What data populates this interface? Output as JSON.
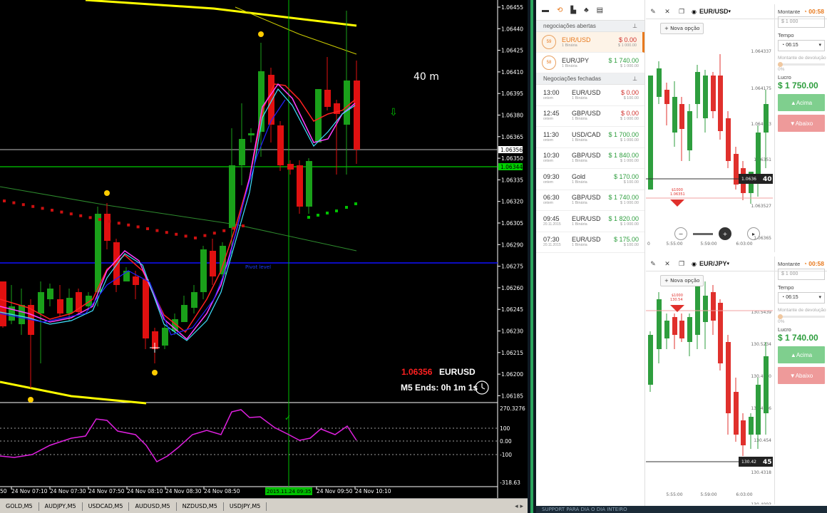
{
  "metatrader": {
    "price_axis": [
      "1.06455",
      "1.06440",
      "1.06425",
      "1.06410",
      "1.06395",
      "1.06380",
      "1.06365",
      "1.06350",
      "1.06335",
      "1.06320",
      "1.06305",
      "1.06290",
      "1.06275",
      "1.06260",
      "1.06245",
      "1.06230",
      "1.06215",
      "1.06200",
      "1.06185"
    ],
    "bid_label": "1.06356",
    "current_label": "1.06344",
    "current_price": "1.06356",
    "symbol": "EURUSD",
    "timeframe_note": "40 m",
    "countdown": "M5 Ends: 0h 1m 1s",
    "pivot_label": "Pivot level",
    "rsi_axis": [
      "270.3276",
      "100",
      "0.00",
      "-100",
      "-318.63"
    ],
    "time_axis": [
      "24 Nov 07:10",
      "24 Nov 07:30",
      "24 Nov 07:50",
      "24 Nov 08:10",
      "24 Nov 08:30",
      "24 Nov 08:50",
      "24 Nov 09:50",
      "24 Nov 10:10"
    ],
    "time_first": "50",
    "crosshair_time": "2015.11.24 09:35",
    "symbol_tabs": [
      "GOLD,M5",
      "AUDJPY,M5",
      "USDCAD,M5",
      "AUDUSD,M5",
      "NZDUSD,M5",
      "USDJPY,M5"
    ],
    "colors": {
      "up": "#1aa01a",
      "down": "#e01010",
      "price_line": "#00ff00",
      "envelope": "#ffff00"
    }
  },
  "platform": {
    "toolbar_icons": [
      "menu-icon",
      "history-icon",
      "chart-icon",
      "people-icon",
      "news-icon"
    ],
    "open_section": "negociações abertas",
    "open_trades": [
      {
        "timer": "59",
        "asset": "EUR/USD",
        "sub": "1 Binária",
        "amount": "$ 0.00",
        "stake": "$ 1 000.00",
        "color": "red"
      },
      {
        "timer": "58",
        "asset": "EUR/JPY",
        "sub": "1 Binária",
        "amount": "$ 1 740.00",
        "stake": "$ 1 000.00",
        "color": "green"
      }
    ],
    "closed_section": "Negociações fechadas",
    "closed_trades": [
      {
        "time": "13:00",
        "day": "ontem",
        "asset": "EUR/USD",
        "sub": "1 Binária",
        "amount": "$ 0.00",
        "stake": "$ 100.00",
        "color": "red"
      },
      {
        "time": "12:45",
        "day": "ontem",
        "asset": "GBP/USD",
        "sub": "1 Binária",
        "amount": "$ 0.00",
        "stake": "$ 1 000.00",
        "color": "red"
      },
      {
        "time": "11:30",
        "day": "ontem",
        "asset": "USD/CAD",
        "sub": "1 Binária",
        "amount": "$ 1 700.00",
        "stake": "$ 1 000.00",
        "color": "green"
      },
      {
        "time": "10:30",
        "day": "ontem",
        "asset": "GBP/USD",
        "sub": "1 Binária",
        "amount": "$ 1 840.00",
        "stake": "$ 1 000.00",
        "color": "green"
      },
      {
        "time": "09:30",
        "day": "ontem",
        "asset": "Gold",
        "sub": "1 Binária",
        "amount": "$ 170.00",
        "stake": "$ 100.00",
        "color": "green"
      },
      {
        "time": "06:30",
        "day": "ontem",
        "asset": "GBP/USD",
        "sub": "1 Binária",
        "amount": "$ 1 740.00",
        "stake": "$ 1 000.00",
        "color": "green"
      },
      {
        "time": "09:45",
        "day": "20.11.2015",
        "asset": "EUR/USD",
        "sub": "1 Binária",
        "amount": "$ 1 820.00",
        "stake": "$ 1 000.00",
        "color": "green"
      },
      {
        "time": "07:30",
        "day": "20.11.2015",
        "asset": "EUR/USD",
        "sub": "1 Binária",
        "amount": "$ 175.00",
        "stake": "$ 100.00",
        "color": "green"
      }
    ],
    "panels": [
      {
        "pair": "EUR/USD",
        "countdown": "00:58",
        "nova": "Nova opção",
        "price_axis": [
          "1.064337",
          "1.064175",
          "1.064013",
          "1.06351",
          "1.063689",
          "1.063527",
          "1.06365"
        ],
        "price_tag_a": "1.0636",
        "price_tag_b": "40",
        "strike_a": "$1000",
        "strike_b": "1.06351",
        "times": [
          "5:55:00",
          "5:59:00",
          "6:03:00"
        ],
        "time_start": "0",
        "montante_label": "Montante",
        "montante": "1 000",
        "tempo_label": "Tempo",
        "tempo": "06:15",
        "devolucao_label": "Montante de devolução",
        "devolucao_pct": "0%",
        "lucro_label": "Lucro",
        "lucro": "$ 1 750.00",
        "acima": "Acima",
        "abaixo": "Abaixo"
      },
      {
        "pair": "EUR/JPY",
        "countdown": "00:58",
        "nova": "Nova opção",
        "price_axis": [
          "130.5439",
          "130.5234",
          "130.4980",
          "130.4766",
          "130.454",
          "130.4318",
          "130.4093"
        ],
        "price_tag_a": "130.42",
        "price_tag_b": "45",
        "strike_a": "$1000",
        "strike_b": "130.54",
        "times": [
          "5:55:00",
          "5:59:00",
          "6:03:00"
        ],
        "time_start": "",
        "montante_label": "Montante",
        "montante": "1 000",
        "tempo_label": "Tempo",
        "tempo": "06:15",
        "devolucao_label": "Montante de devolução",
        "devolucao_pct": "0%",
        "lucro_label": "Lucro",
        "lucro": "$ 1 740.00",
        "acima": "Acima",
        "abaixo": "Abaixo"
      }
    ],
    "bottom_bar": "SUPPORT        PARA DIA O DIA INTEIRO"
  }
}
